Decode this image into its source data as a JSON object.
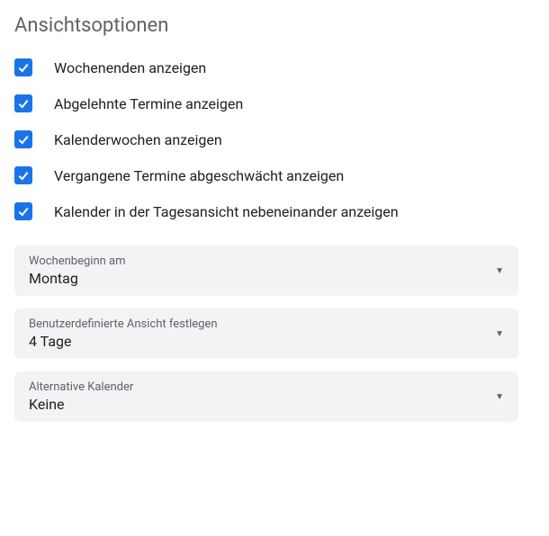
{
  "heading": "Ansichtsoptionen",
  "checkboxes": [
    {
      "label": "Wochenenden anzeigen",
      "checked": true
    },
    {
      "label": "Abgelehnte Termine anzeigen",
      "checked": true
    },
    {
      "label": "Kalenderwochen anzeigen",
      "checked": true
    },
    {
      "label": "Vergangene Termine abgeschwächt anzeigen",
      "checked": true
    },
    {
      "label": "Kalender in der Tagesansicht nebeneinander anzeigen",
      "checked": true
    }
  ],
  "dropdowns": [
    {
      "label": "Wochenbeginn am",
      "value": "Montag"
    },
    {
      "label": "Benutzerdefinierte Ansicht festlegen",
      "value": "4 Tage"
    },
    {
      "label": "Alternative Kalender",
      "value": "Keine"
    }
  ]
}
